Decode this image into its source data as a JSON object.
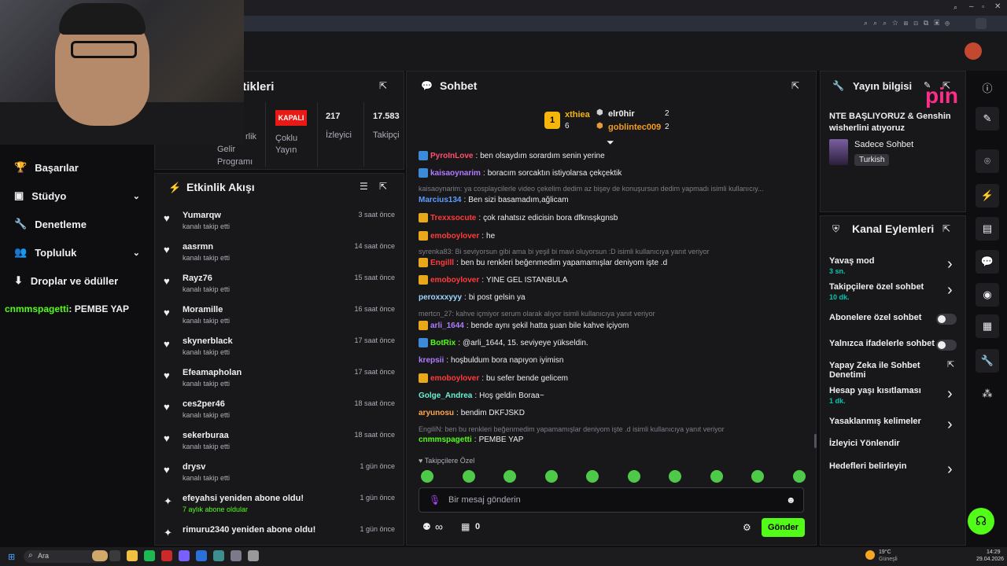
{
  "stats": {
    "title_fragment": "stikleri",
    "items": [
      {
        "value": "",
        "line1": "rlik",
        "line2": "Gelir",
        "line3": "Programı"
      },
      {
        "value": "KAPALI",
        "line1": "Çoklu",
        "line2": "Yayın"
      },
      {
        "value": "217",
        "line1": "İzleyici"
      },
      {
        "value": "17.583",
        "line1": "Takipçi"
      }
    ]
  },
  "leftnav": {
    "items": [
      {
        "label": "Başarılar"
      },
      {
        "label": "Stüdyo"
      },
      {
        "label": "Denetleme"
      },
      {
        "label": "Topluluk"
      },
      {
        "label": "Droplar ve ödüller"
      }
    ],
    "overlay_user": "cnmmspagetti",
    "overlay_text": ": PEMBE YAP"
  },
  "activity": {
    "title": "Etkinlik Akışı",
    "items": [
      {
        "name": "Yumarqw",
        "sub": "kanalı takip etti",
        "time": "3 saat önce"
      },
      {
        "name": "aasrmn",
        "sub": "kanalı takip etti",
        "time": "14 saat önce"
      },
      {
        "name": "Rayz76",
        "sub": "kanalı takip etti",
        "time": "15 saat önce"
      },
      {
        "name": "Moramille",
        "sub": "kanalı takip etti",
        "time": "16 saat önce"
      },
      {
        "name": "skynerblack",
        "sub": "kanalı takip etti",
        "time": "17 saat önce"
      },
      {
        "name": "Efeamapholan",
        "sub": "kanalı takip etti",
        "time": "17 saat önce"
      },
      {
        "name": "ces2per46",
        "sub": "kanalı takip etti",
        "time": "18 saat önce"
      },
      {
        "name": "sekerburaa",
        "sub": "kanalı takip etti",
        "time": "18 saat önce"
      },
      {
        "name": "drysv",
        "sub": "kanalı takip etti",
        "time": "1 gün önce"
      },
      {
        "name": "efeyahsi yeniden abone oldu!",
        "sub": "7 aylık abone oldular",
        "time": "1 gün önce"
      },
      {
        "name": "rimuru2340 yeniden abone oldu!",
        "sub": "",
        "time": "1 gün önce"
      }
    ]
  },
  "chat": {
    "title": "Sohbet",
    "leaderboard": {
      "first_name": "xthiea",
      "first_count": "6",
      "rank": "1",
      "second_name": "elr0hir",
      "second_count": "2",
      "third_name": "goblintec009",
      "third_count": "2"
    },
    "messages": [
      {
        "type": "msg",
        "user": "PyroInLove",
        "color": "#ff4f6d",
        "text": "ben olsaydım sorardım senin yerine"
      },
      {
        "type": "msg",
        "user": "kaisaoynarim",
        "color": "#b07cff",
        "text": "boracım sorcaktın istiyolarsa çekçektik"
      },
      {
        "type": "reply",
        "text": "kaisaoynarim: ya cosplaycilerle video çekelim dedim az bişey de konuşursun dedim yapmadı isimli kullanıcıy..."
      },
      {
        "type": "msg",
        "user": "Marcius134",
        "color": "#5f9cff",
        "text": "Ben sizi basamadım,ağlicam"
      },
      {
        "type": "msg",
        "user": "Trexxsocute",
        "color": "#ff3b3b",
        "text": "çok rahatsız edicisin bora dfknsşkgnsb"
      },
      {
        "type": "msg",
        "user": "emoboylover",
        "color": "#ff3b3b",
        "text": "he"
      },
      {
        "type": "reply",
        "text": "syrenka83: Bi seviyorsun gibi ama bi yeşil bi mavi oluyorsun :D isimli kullanıcıya yanıt veriyor"
      },
      {
        "type": "msg",
        "user": "Engilll",
        "color": "#ff3b3b",
        "text": "ben bu renkleri beğenmedim yapamamışlar deniyom işte .d"
      },
      {
        "type": "msg",
        "user": "emoboylover",
        "color": "#ff3b3b",
        "text": "YINE GEL ISTANBULA"
      },
      {
        "type": "msg",
        "user": "peroxxxyyy",
        "color": "#9bd7ff",
        "text": "bi post gelsin ya"
      },
      {
        "type": "reply",
        "text": "mertcn_27: kahve içmiyor serum olarak alıyor isimli kullanıcıya yanıt veriyor"
      },
      {
        "type": "msg",
        "user": "arli_1644",
        "color": "#b07cff",
        "text": "bende aynı şekil hatta şuan bile kahve içiyom"
      },
      {
        "type": "msg",
        "user": "BotRix",
        "color": "#53fc18",
        "text": "@arli_1644, 15. seviyeye yükseldin."
      },
      {
        "type": "msg",
        "user": "krepsii",
        "color": "#b07cff",
        "text": "hoşbuldum bora napıyon iyimisn"
      },
      {
        "type": "msg",
        "user": "emoboylover",
        "color": "#ff3b3b",
        "text": "bu sefer bende gelicem"
      },
      {
        "type": "msg",
        "user": "Golge_Andrea",
        "color": "#6cf0d2",
        "text": "Hoş geldin Boraa~"
      },
      {
        "type": "msg",
        "user": "aryunosu",
        "color": "#ffa64d",
        "text": "bendim DKFJSKD"
      },
      {
        "type": "reply",
        "text": "EngiliN: ben bu renkleri beğenmedim yapamamışlar deniyom işte .d isimli kullanıcıya yanıt veriyor"
      },
      {
        "type": "msg",
        "user": "cnmmspagetti",
        "color": "#53fc18",
        "text": "PEMBE YAP"
      }
    ],
    "followers_only": "Takipçilere Özel",
    "input_placeholder": "Bir mesaj gönderin",
    "infinity": "∞",
    "count": "0",
    "send": "Gönder"
  },
  "stream_info": {
    "title_fragment": "Yayın bilgisi",
    "stream_title": "NTE BAŞLIYORUZ & Genshin wisherlini atıyoruz",
    "category": "Sadece Sohbet",
    "language": "Turkish",
    "overlay_logo": "pin"
  },
  "channel_actions": {
    "title": "Kanal Eylemleri",
    "items": [
      {
        "label": "Yavaş mod",
        "sub": "3 sn."
      },
      {
        "label": "Takipçilere özel sohbet",
        "sub": "10 dk."
      },
      {
        "label": "Abonelere özel sohbet",
        "sub": ""
      },
      {
        "label": "Yalnızca ifadelerle sohbet",
        "sub": ""
      },
      {
        "label": "Yapay Zeka ile Sohbet Denetimi",
        "sub": ""
      },
      {
        "label": "Hesap yaşı kısıtlaması",
        "sub": "1 dk."
      },
      {
        "label": "Yasaklanmış kelimeler",
        "sub": ""
      },
      {
        "label": "İzleyici Yönlendir",
        "sub": ""
      },
      {
        "label": "Hedefleri belirleyin",
        "sub": ""
      }
    ]
  },
  "taskbar": {
    "search": "Ara",
    "weather_temp": "19°C",
    "weather_desc": "Güneşli",
    "time": "14:29",
    "date": "29.04.2026"
  },
  "colors": {
    "accent": "#53fc18",
    "panel": "#18181b",
    "bg": "#0e0e10"
  }
}
